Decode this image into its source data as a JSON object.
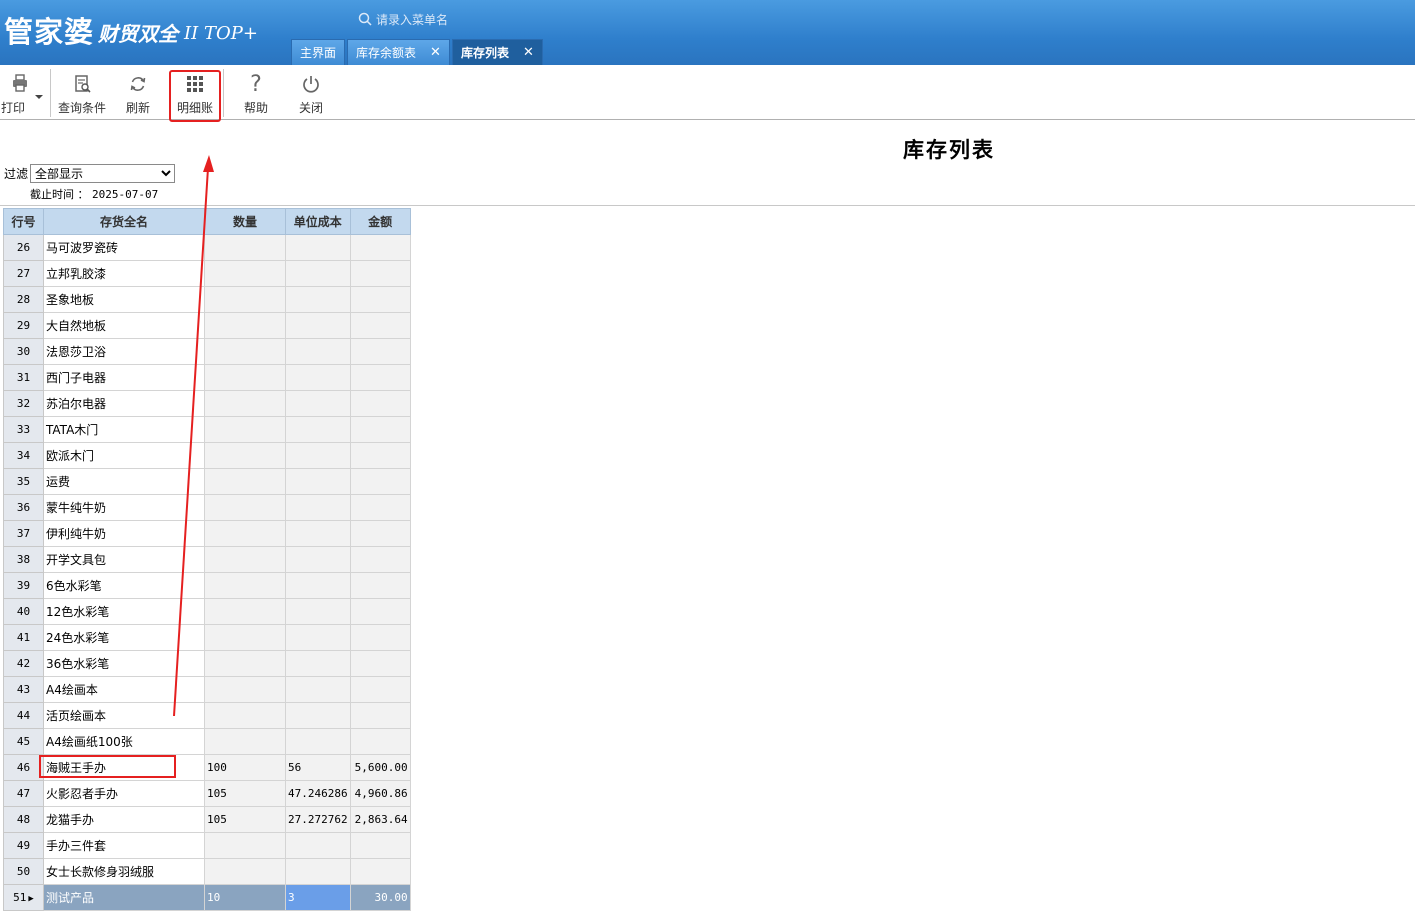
{
  "app": {
    "logo_main": "管家婆",
    "logo_sub": "财贸双全",
    "logo_version": "II TOP+"
  },
  "search": {
    "placeholder": "请录入菜单名"
  },
  "tabs": [
    {
      "label": "主界面",
      "closable": false,
      "active": false
    },
    {
      "label": "库存余额表",
      "closable": true,
      "active": false
    },
    {
      "label": "库存列表",
      "closable": true,
      "active": true
    }
  ],
  "toolbar": {
    "print": "打印",
    "query": "查询条件",
    "refresh": "刷新",
    "detail": "明细账",
    "help": "帮助",
    "close": "关闭"
  },
  "report": {
    "title": "库存列表",
    "filter_label": "过滤",
    "filter_value": "全部显示",
    "cutoff_label": "截止时间 ：",
    "cutoff_date": "2025-07-07"
  },
  "table": {
    "headers": [
      "行号",
      "存货全名",
      "数量",
      "单位成本",
      "金额"
    ],
    "rows": [
      [
        "26",
        "马可波罗瓷砖",
        "",
        "",
        ""
      ],
      [
        "27",
        "立邦乳胶漆",
        "",
        "",
        ""
      ],
      [
        "28",
        "圣象地板",
        "",
        "",
        ""
      ],
      [
        "29",
        "大自然地板",
        "",
        "",
        ""
      ],
      [
        "30",
        "法恩莎卫浴",
        "",
        "",
        ""
      ],
      [
        "31",
        "西门子电器",
        "",
        "",
        ""
      ],
      [
        "32",
        "苏泊尔电器",
        "",
        "",
        ""
      ],
      [
        "33",
        "TATA木门",
        "",
        "",
        ""
      ],
      [
        "34",
        "欧派木门",
        "",
        "",
        ""
      ],
      [
        "35",
        "运费",
        "",
        "",
        ""
      ],
      [
        "36",
        "蒙牛纯牛奶",
        "",
        "",
        ""
      ],
      [
        "37",
        "伊利纯牛奶",
        "",
        "",
        ""
      ],
      [
        "38",
        "开学文具包",
        "",
        "",
        ""
      ],
      [
        "39",
        "6色水彩笔",
        "",
        "",
        ""
      ],
      [
        "40",
        "12色水彩笔",
        "",
        "",
        ""
      ],
      [
        "41",
        "24色水彩笔",
        "",
        "",
        ""
      ],
      [
        "42",
        "36色水彩笔",
        "",
        "",
        ""
      ],
      [
        "43",
        "A4绘画本",
        "",
        "",
        ""
      ],
      [
        "44",
        "活页绘画本",
        "",
        "",
        ""
      ],
      [
        "45",
        "A4绘画纸100张",
        "",
        "",
        ""
      ],
      [
        "46",
        "海贼王手办",
        "100",
        "56",
        "5,600.00"
      ],
      [
        "47",
        "火影忍者手办",
        "105",
        "47.246286",
        "4,960.86"
      ],
      [
        "48",
        "龙猫手办",
        "105",
        "27.272762",
        "2,863.64"
      ],
      [
        "49",
        "手办三件套",
        "",
        "",
        ""
      ],
      [
        "50",
        "女士长款修身羽绒服",
        "",
        "",
        ""
      ],
      [
        "51",
        "测试产品",
        "10",
        "3",
        "30.00"
      ]
    ],
    "selected_row": "51"
  },
  "colors": {
    "header_blue": "#2f7fcc",
    "annotation_red": "#e52020",
    "grid_header": "#c3d9ee",
    "selected_row": "#8aa4c0"
  }
}
